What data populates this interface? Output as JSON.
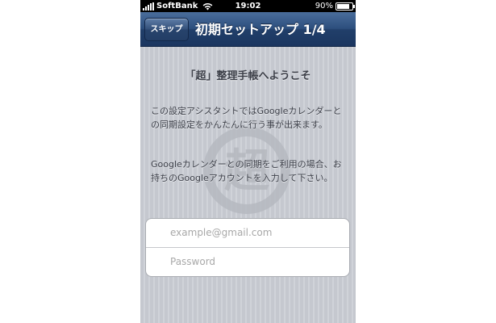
{
  "status_bar": {
    "carrier": "SoftBank",
    "time": "19:02",
    "battery": "90%",
    "battery_level": 0.9
  },
  "nav": {
    "skip_label": "スキップ",
    "title": "初期セットアップ 1/4"
  },
  "main": {
    "welcome": "「超」整理手帳へようこそ",
    "paragraph1": "この設定アシスタントではGoogleカレンダーとの同期設定をかんたんに行う事が出来ます。",
    "paragraph2": "Googleカレンダーとの同期をご利用の場合、お持ちのGoogleアカウントを入力して下さい。",
    "watermark_icon": "chou-logo-icon",
    "watermark_text": "超"
  },
  "form": {
    "email_placeholder": "example@gmail.com",
    "email_value": "",
    "password_placeholder": "Password",
    "password_value": ""
  },
  "colors": {
    "navbar": "#2d4f7e",
    "background": "#c9ccd3",
    "text": "#3c3f48"
  }
}
